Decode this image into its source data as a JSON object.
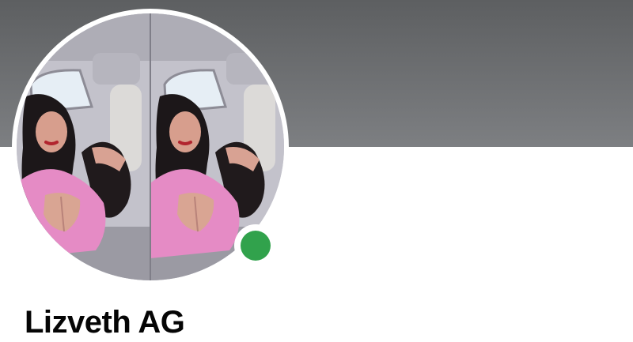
{
  "profile": {
    "name": "Lizveth AG",
    "status": "online",
    "status_color": "#31a24c"
  },
  "cover": {
    "color_top": "#5d5f61",
    "color_bottom": "#7d7f82"
  }
}
